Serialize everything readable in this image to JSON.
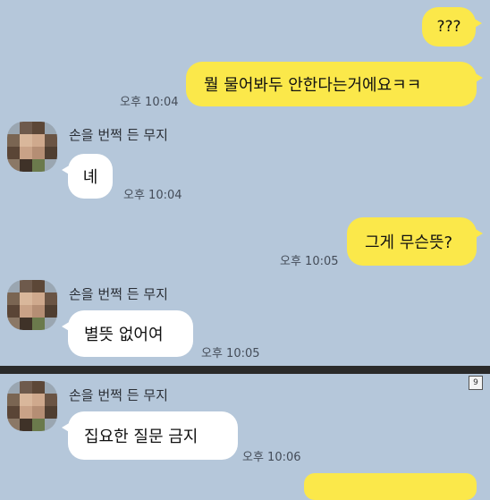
{
  "messages": {
    "m1": {
      "text": "???"
    },
    "m2": {
      "text": "뭘 물어봐두 안한다는거에요ㅋㅋ",
      "time": "오후 10:04"
    },
    "m3": {
      "sender": "손을 번쩍 든 무지",
      "text": "녜",
      "time": "오후 10:04"
    },
    "m4": {
      "text": "그게 무슨뜻?",
      "time": "오후 10:05"
    },
    "m5": {
      "sender": "손을 번쩍 든 무지",
      "text": "별뜻 없어여",
      "time": "오후 10:05"
    },
    "m6": {
      "sender": "손을 번쩍 든 무지",
      "text": "집요한 질문 금지",
      "time": "오후 10:06"
    }
  },
  "page_badge": "9",
  "colors": {
    "background": "#b5c7da",
    "my_bubble": "#fbe84a",
    "their_bubble": "#ffffff",
    "divider": "#2a2a2a"
  },
  "icons": {
    "avatar": "blurred-profile-photo"
  }
}
